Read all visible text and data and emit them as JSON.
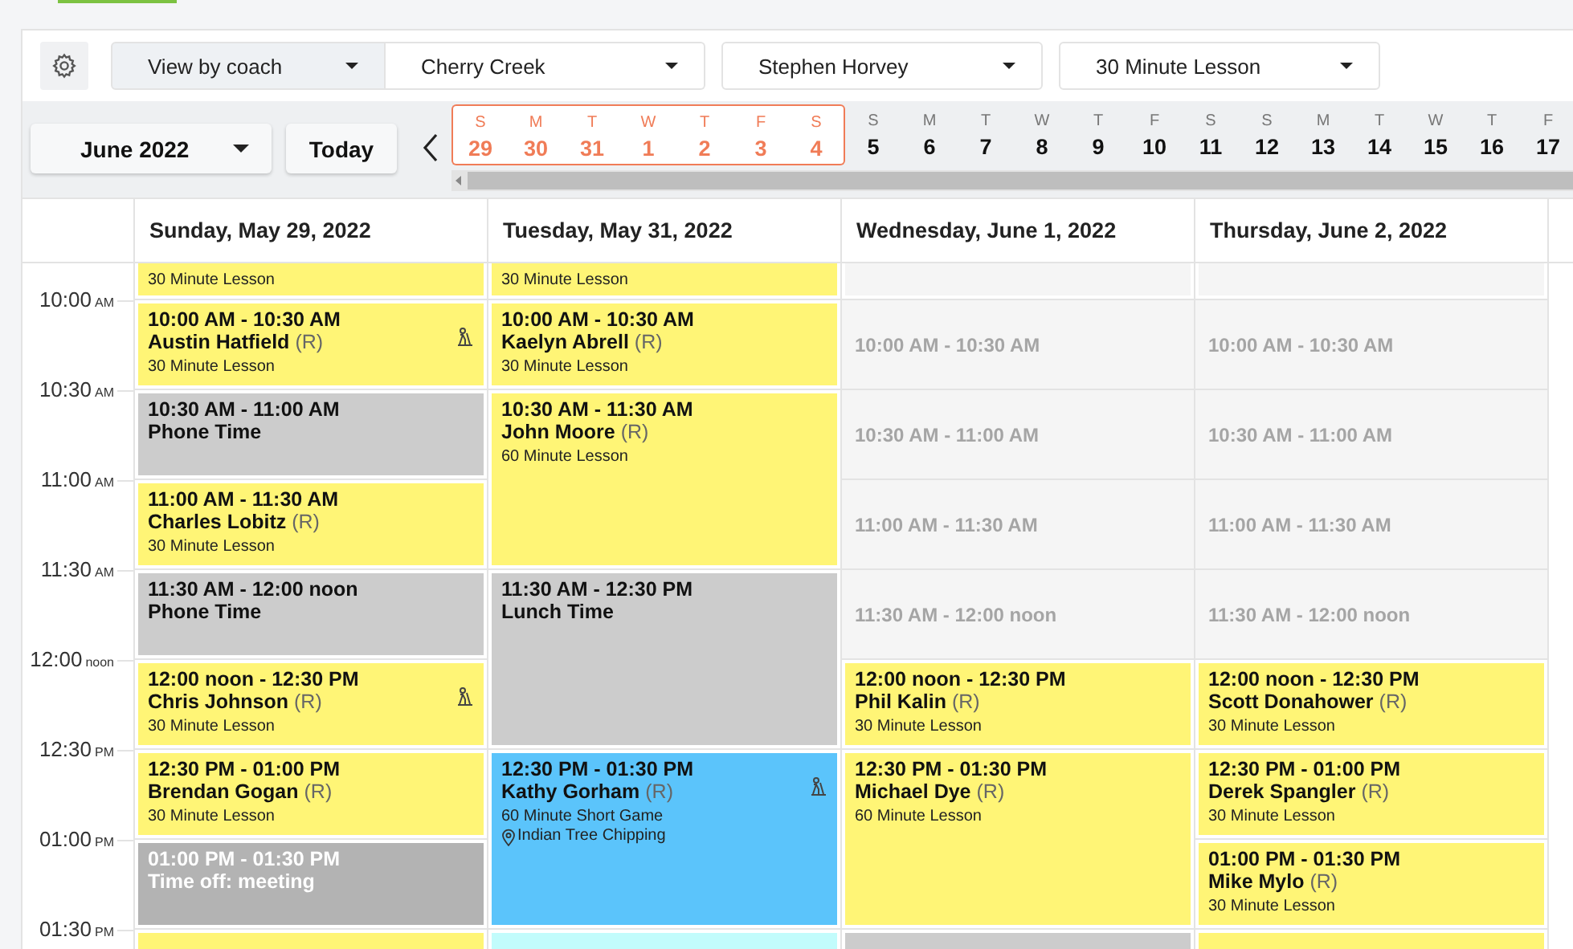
{
  "toolbar": {
    "dropdowns": [
      {
        "label": "View by coach",
        "selected": true
      },
      {
        "label": "Cherry Creek",
        "selected": false
      },
      {
        "label": "Stephen Horvey",
        "selected": false
      },
      {
        "label": "30 Minute Lesson",
        "selected": false
      }
    ]
  },
  "date_nav": {
    "month": "June 2022",
    "today": "Today",
    "days": [
      {
        "weekday": "S",
        "date": "29",
        "selected": true
      },
      {
        "weekday": "M",
        "date": "30",
        "selected": true
      },
      {
        "weekday": "T",
        "date": "31",
        "selected": true
      },
      {
        "weekday": "W",
        "date": "1",
        "selected": true
      },
      {
        "weekday": "T",
        "date": "2",
        "selected": true
      },
      {
        "weekday": "F",
        "date": "3",
        "selected": true
      },
      {
        "weekday": "S",
        "date": "4",
        "selected": true
      },
      {
        "weekday": "S",
        "date": "5",
        "selected": false
      },
      {
        "weekday": "M",
        "date": "6",
        "selected": false
      },
      {
        "weekday": "T",
        "date": "7",
        "selected": false
      },
      {
        "weekday": "W",
        "date": "8",
        "selected": false
      },
      {
        "weekday": "T",
        "date": "9",
        "selected": false
      },
      {
        "weekday": "F",
        "date": "10",
        "selected": false
      },
      {
        "weekday": "S",
        "date": "11",
        "selected": false
      },
      {
        "weekday": "S",
        "date": "12",
        "selected": false
      },
      {
        "weekday": "M",
        "date": "13",
        "selected": false
      },
      {
        "weekday": "T",
        "date": "14",
        "selected": false
      },
      {
        "weekday": "W",
        "date": "15",
        "selected": false
      },
      {
        "weekday": "T",
        "date": "16",
        "selected": false
      },
      {
        "weekday": "F",
        "date": "17",
        "selected": false
      }
    ]
  },
  "times": [
    {
      "time": "10:00",
      "suffix": "AM"
    },
    {
      "time": "10:30",
      "suffix": "AM"
    },
    {
      "time": "11:00",
      "suffix": "AM"
    },
    {
      "time": "11:30",
      "suffix": "AM"
    },
    {
      "time": "12:00",
      "suffix": "noon"
    },
    {
      "time": "12:30",
      "suffix": "PM"
    },
    {
      "time": "01:00",
      "suffix": "PM"
    },
    {
      "time": "01:30",
      "suffix": "PM"
    }
  ],
  "columns": [
    {
      "title": "Sunday, May 29, 2022",
      "events": [
        {
          "kind": "cut_top",
          "color": "#fff576",
          "type": "30 Minute Lesson"
        },
        {
          "kind": "appointment",
          "color": "#fff576",
          "time": "10:00 AM - 10:30 AM",
          "name": "Austin Hatfield",
          "tag": "(R)",
          "type": "30 Minute Lesson",
          "figure": true
        },
        {
          "kind": "block",
          "color": "#cccccc",
          "time": "10:30 AM - 11:00 AM",
          "title": "Phone Time"
        },
        {
          "kind": "appointment",
          "color": "#fff576",
          "time": "11:00 AM - 11:30 AM",
          "name": "Charles Lobitz",
          "tag": "(R)",
          "type": "30 Minute Lesson",
          "figure": false
        },
        {
          "kind": "block",
          "color": "#cccccc",
          "time": "11:30 AM - 12:00 noon",
          "title": "Phone Time"
        },
        {
          "kind": "appointment",
          "color": "#fff576",
          "time": "12:00 noon - 12:30 PM",
          "name": "Chris Johnson",
          "tag": "(R)",
          "type": "30 Minute Lesson",
          "figure": true
        },
        {
          "kind": "appointment",
          "color": "#fff576",
          "time": "12:30 PM - 01:00 PM",
          "name": "Brendan Gogan",
          "tag": "(R)",
          "type": "30 Minute Lesson",
          "figure": false
        },
        {
          "kind": "time_off",
          "color": "#b3b3b3",
          "time": "01:00 PM - 01:30 PM",
          "title": "Time off: meeting"
        },
        {
          "kind": "cut_bottom",
          "color": "#fff576"
        }
      ]
    },
    {
      "title": "Tuesday, May 31, 2022",
      "events": [
        {
          "kind": "cut_top",
          "color": "#fff576",
          "type": "30 Minute Lesson"
        },
        {
          "kind": "appointment",
          "color": "#fff576",
          "time": "10:00 AM - 10:30 AM",
          "name": "Kaelyn Abrell",
          "tag": "(R)",
          "type": "30 Minute Lesson",
          "figure": false
        },
        {
          "kind": "appointment",
          "color": "#fff576",
          "time": "10:30 AM - 11:30 AM",
          "name": "John Moore",
          "tag": "(R)",
          "type": "60 Minute Lesson",
          "figure": false
        },
        {
          "kind": "block",
          "color": "#cccccc",
          "time": "11:30 AM - 12:30 PM",
          "title": "Lunch Time"
        },
        {
          "kind": "appointment",
          "color": "#5bc4fb",
          "time": "12:30 PM - 01:30 PM",
          "name": "Kathy Gorham",
          "tag": "(R)",
          "type": "60 Minute Short Game",
          "location": "Indian Tree Chipping",
          "figure": true
        },
        {
          "kind": "cut_bottom",
          "color": "#c2fcfc"
        }
      ]
    },
    {
      "title": "Wednesday, June 1, 2022",
      "events": [
        {
          "kind": "cut_top",
          "color": "#f5f5f5"
        },
        {
          "kind": "open",
          "color": "#f5f5f5",
          "time": "10:00 AM - 10:30 AM"
        },
        {
          "kind": "open",
          "color": "#f5f5f5",
          "time": "10:30 AM - 11:00 AM"
        },
        {
          "kind": "open",
          "color": "#f5f5f5",
          "time": "11:00 AM - 11:30 AM"
        },
        {
          "kind": "open",
          "color": "#f5f5f5",
          "time": "11:30 AM - 12:00 noon"
        },
        {
          "kind": "appointment",
          "color": "#fff576",
          "time": "12:00 noon - 12:30 PM",
          "name": "Phil Kalin",
          "tag": "(R)",
          "type": "30 Minute Lesson",
          "figure": false
        },
        {
          "kind": "appointment",
          "color": "#fff576",
          "time": "12:30 PM - 01:30 PM",
          "name": "Michael Dye",
          "tag": "(R)",
          "type": "60 Minute Lesson",
          "figure": false
        },
        {
          "kind": "cut_bottom",
          "color": "#cccccc"
        }
      ]
    },
    {
      "title": "Thursday, June 2, 2022",
      "events": [
        {
          "kind": "cut_top",
          "color": "#f5f5f5"
        },
        {
          "kind": "open",
          "color": "#f5f5f5",
          "time": "10:00 AM - 10:30 AM"
        },
        {
          "kind": "open",
          "color": "#f5f5f5",
          "time": "10:30 AM - 11:00 AM"
        },
        {
          "kind": "open",
          "color": "#f5f5f5",
          "time": "11:00 AM - 11:30 AM"
        },
        {
          "kind": "open",
          "color": "#f5f5f5",
          "time": "11:30 AM - 12:00 noon"
        },
        {
          "kind": "appointment",
          "color": "#fff576",
          "time": "12:00 noon - 12:30 PM",
          "name": "Scott Donahower",
          "tag": "(R)",
          "type": "30 Minute Lesson",
          "figure": false
        },
        {
          "kind": "appointment",
          "color": "#fff576",
          "time": "12:30 PM - 01:00 PM",
          "name": "Derek Spangler",
          "tag": "(R)",
          "type": "30 Minute Lesson",
          "figure": false
        },
        {
          "kind": "appointment",
          "color": "#fff576",
          "time": "01:00 PM - 01:30 PM",
          "name": "Mike Mylo",
          "tag": "(R)",
          "type": "30 Minute Lesson",
          "figure": false
        },
        {
          "kind": "cut_bottom",
          "color": "#fff576"
        }
      ]
    }
  ]
}
